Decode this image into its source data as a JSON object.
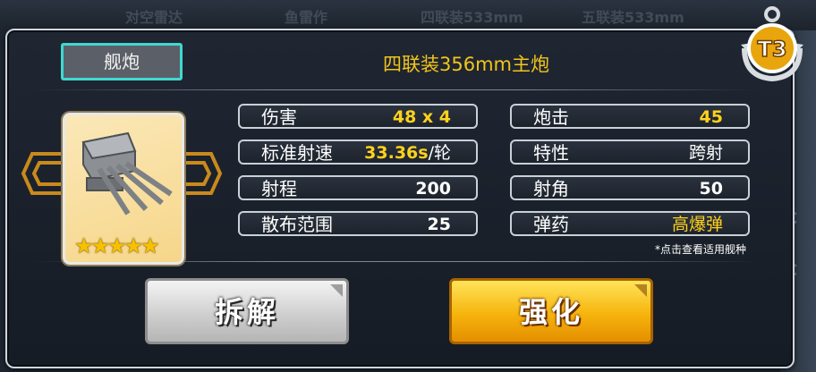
{
  "background": {
    "tabs": [
      "对空雷达",
      "鱼雷作",
      "四联装533mm",
      "五联装533mm"
    ],
    "side_text": [
      "C",
      "C"
    ]
  },
  "equipment": {
    "type_label": "舰炮",
    "name": "四联装356mm主炮",
    "tier": "T3",
    "rarity_stars": "★★★★★",
    "icon": "naval-gun-turret-icon"
  },
  "stats_left": [
    {
      "label": "伤害",
      "value": "48 x 4",
      "unit": ""
    },
    {
      "label": "标准射速",
      "value": "33.36s",
      "unit": "/轮"
    },
    {
      "label": "射程",
      "value": "200",
      "unit": ""
    },
    {
      "label": "散布范围",
      "value": "25",
      "unit": ""
    }
  ],
  "stats_right": [
    {
      "label": "炮击",
      "value": "45"
    },
    {
      "label": "特性",
      "value": "跨射"
    },
    {
      "label": "射角",
      "value": "50"
    },
    {
      "label": "弹药",
      "value": "高爆弹"
    }
  ],
  "hint": "*点击查看适用舰种",
  "buttons": {
    "dismantle": "拆解",
    "enhance": "强化"
  },
  "colors": {
    "accent_yellow": "#ffd21c",
    "tag_border": "#3fd9d0",
    "enhance_button": "#f6b40d",
    "dismantle_button": "#cfcfcf"
  }
}
